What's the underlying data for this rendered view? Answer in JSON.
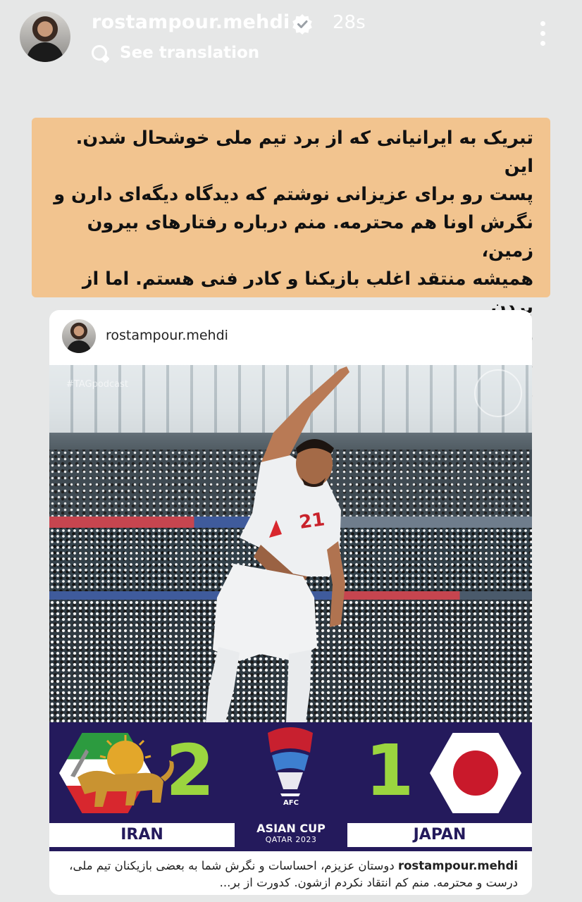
{
  "story": {
    "username": "rostampour.mehdi",
    "time": "28s",
    "translate": "See translation"
  },
  "caption": {
    "text": "تبریک به ایرانیانی که از برد تیم ملی خوشحال شدن. این\nپست رو برای عزیزانی نوشتم که دیدگاه دیگه‌ای دارن و\nنگرش اونا هم محترمه. منم درباره رفتارهای بیرون زمین،\nهمیشه منتقد اغلب بازیکنا و کادر فنی هستم. اما از بردن\nژاپن خوشحالم. همیشه باید طرف حقیقت ایستاد، می‌شه\nوظایف ورزشی و مسئولیت اجتماعی رو جداگانه سنجید"
  },
  "post": {
    "username": "rostampour.mehdi",
    "watermark": "#TAGpodcast",
    "jersey_number": "21",
    "home_team": "IRAN",
    "home_score": "2",
    "away_team": "JAPAN",
    "away_score": "1",
    "tournament_org": "AFC",
    "tournament_name": "ASIAN CUP",
    "tournament_sub": "QATAR 2023",
    "caption_user": "rostampour.mehdi",
    "caption_text": "دوستان عزیزم، احساسات و نگرش شما به بعضی بازیکنان تیم ملی، درست و محترمه. منم کم انتقاد نکردم ازشون. کدورت از بر..."
  },
  "colors": {
    "caption_bg": "#f2c48f",
    "score_band": "#241a5c",
    "score_text": "#9bd53f",
    "japan_red": "#c9192b"
  }
}
